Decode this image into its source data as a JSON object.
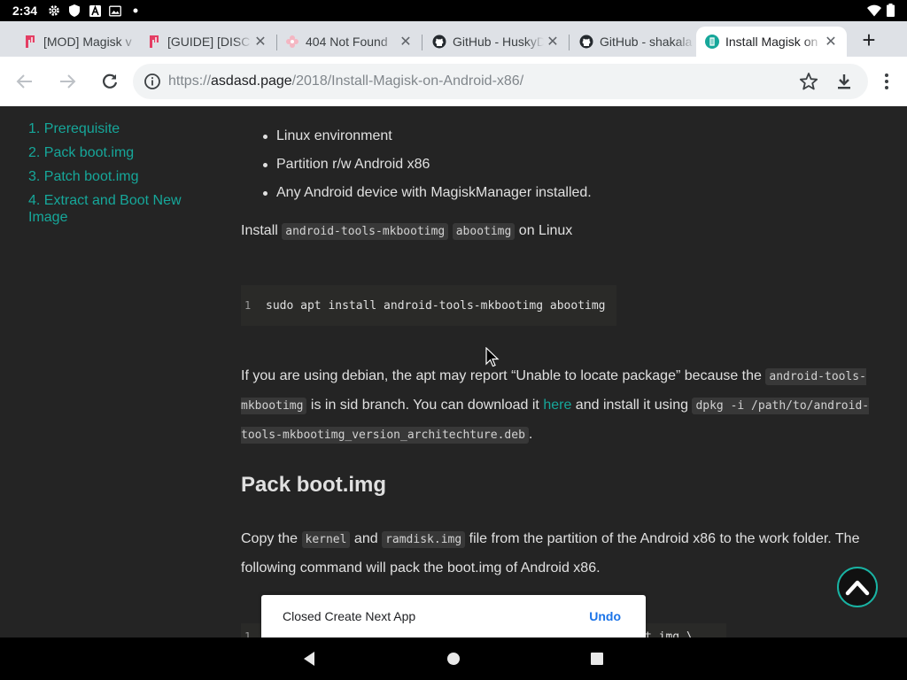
{
  "status_bar": {
    "time": "2:34",
    "icons": [
      "gear-icon",
      "shield-icon",
      "a-icon",
      "photo-icon",
      "dot-icon"
    ],
    "right_icons": [
      "wifi-icon",
      "battery-icon"
    ]
  },
  "tabs": [
    {
      "title": "[MOD] Magisk v",
      "favicon": "xda-icon",
      "active": false
    },
    {
      "title": "[GUIDE] [DISCUS",
      "favicon": "xda-icon",
      "active": false
    },
    {
      "title": "404 Not Found",
      "favicon": "flower-icon",
      "active": false
    },
    {
      "title": "GitHub - HuskyD",
      "favicon": "github-icon",
      "active": false
    },
    {
      "title": "GitHub - shakala",
      "favicon": "github-icon",
      "active": false
    },
    {
      "title": "Install Magisk on",
      "favicon": "site-icon",
      "active": true
    }
  ],
  "toolbar": {
    "url_scheme": "https://",
    "url_host": "asdasd.page",
    "url_path": "/2018/Install-Magisk-on-Android-x86/"
  },
  "toc": {
    "items": [
      "1. Prerequisite",
      "2. Pack boot.img",
      "3. Patch boot.img",
      "4. Extract and Boot New Image"
    ]
  },
  "article": {
    "bullets": [
      "Linux environment",
      "Partition r/w Android x86",
      "Any Android device with MagiskManager installed."
    ],
    "install_prefix": "Install",
    "install_code1": "android-tools-mkbootimg",
    "install_code2": "abootimg",
    "install_suffix": "on Linux",
    "code_line_number": "1",
    "code_command": "sudo apt install android-tools-mkbootimg abootimg",
    "debian_text1": "If you are using debian, the apt may report “Unable to locate package” because the",
    "debian_code1": "android-tools-mkbootimg",
    "debian_text2": "is in sid branch. You can download it",
    "debian_link": "here",
    "debian_text3": "and install it using",
    "debian_code2": "dpkg -i /path/to/android-tools-mkbootimg_version_architechture.deb",
    "debian_text4": ".",
    "heading": "Pack boot.img",
    "copy_text1": "Copy the",
    "copy_code1": "kernel",
    "copy_text2": "and",
    "copy_code2": "ramdisk.img",
    "copy_text3": "file from the partition of the Android x86 to the work folder. The following command will pack the boot.img of Android x86.",
    "code2_line_number": "1",
    "code2_tail": "t.img \\"
  },
  "snackbar": {
    "message": "Closed Create Next App",
    "action": "Undo"
  },
  "colors": {
    "accent": "#16a79a",
    "page_bg": "#242424",
    "tabstrip_bg": "#dee1e6",
    "snackbar_action": "#1a73e8"
  }
}
